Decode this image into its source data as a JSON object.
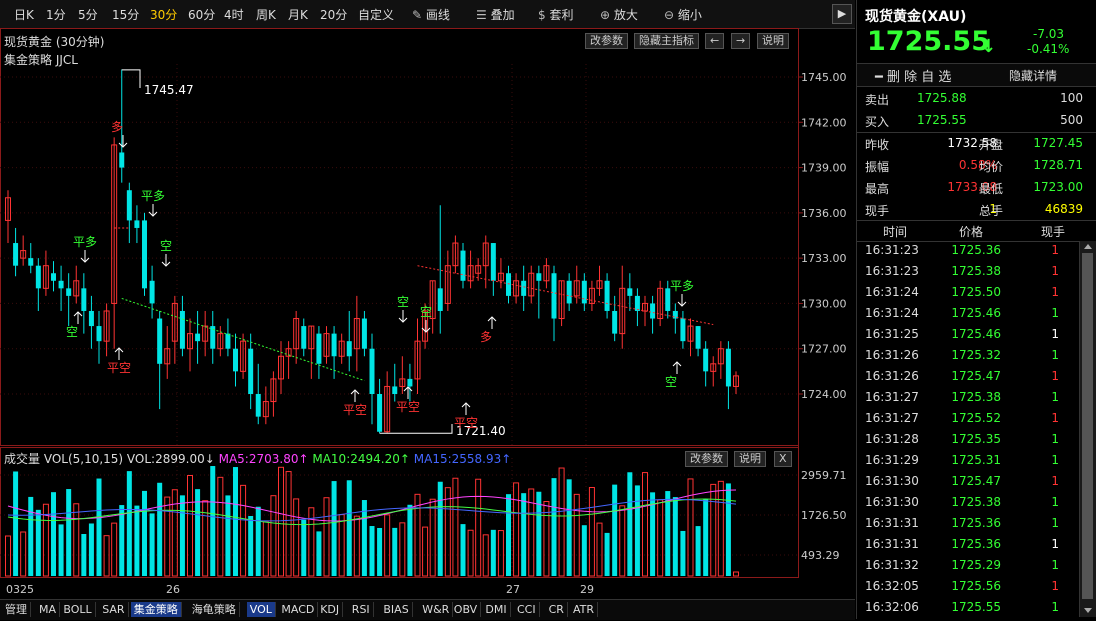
{
  "toolbar": {
    "periods": [
      "日K",
      "1分",
      "5分",
      "15分",
      "30分",
      "60分",
      "4时",
      "周K",
      "月K",
      "20分",
      "自定义"
    ],
    "active_period": "30分",
    "tools": [
      {
        "icon": "pencil-icon",
        "label": "画线"
      },
      {
        "icon": "stack-icon",
        "label": "叠加"
      },
      {
        "icon": "moneybag-icon",
        "label": "套利"
      },
      {
        "icon": "zoom-in-icon",
        "label": "放大"
      },
      {
        "icon": "zoom-out-icon",
        "label": "缩小"
      }
    ]
  },
  "main_chart": {
    "title": "现货黄金 (30分钟)",
    "strategy": "集金策略 JJCL",
    "buttons": {
      "modify": "改参数",
      "hide": "隐藏主指标",
      "left": "←",
      "right": "→",
      "help": "说明"
    },
    "price_ticks": [
      "1745.00",
      "1742.00",
      "1739.00",
      "1736.00",
      "1733.00",
      "1730.00",
      "1727.00",
      "1724.00"
    ],
    "high_label": "1745.47",
    "low_label": "1721.40",
    "signals": [
      "多",
      "平多",
      "空",
      "平空",
      "空",
      "空",
      "平空",
      "平空",
      "平空",
      "多",
      "平多",
      "空"
    ]
  },
  "volume": {
    "title": "成交量 VOL(5,10,15) VOL:2899.00↓",
    "ma5": "MA5:2703.80↑",
    "ma10": "MA10:2494.20↑",
    "ma15": "MA15:2558.93↑",
    "buttons": {
      "modify": "改参数",
      "help": "说明",
      "close": "X"
    },
    "ticks": [
      "2959.71",
      "1726.50",
      "493.29"
    ],
    "colors": {
      "ma5": "#ff44ff",
      "ma10": "#44ff44",
      "ma15": "#4466ff"
    }
  },
  "xaxis": {
    "labels": [
      "0325",
      "26",
      "27",
      "29"
    ]
  },
  "bottom_tabs": [
    "管理",
    "MA",
    "BOLL",
    "SAR",
    "集金策略",
    "海龟策略",
    "VOL",
    "MACD",
    "KDJ",
    "RSI",
    "BIAS",
    "W&R",
    "OBV",
    "DMI",
    "CCI",
    "CR",
    "ATR"
  ],
  "active_bottom": [
    "集金策略",
    "VOL"
  ],
  "quote": {
    "name": "现货黄金(XAU)",
    "price": "1725.55",
    "arrow": "↓",
    "change": "-7.03",
    "change_pct": "-0.41%",
    "delete_btn": "━ 删 除 自 选",
    "hide_btn": "隐藏详情",
    "sell_label": "卖出",
    "sell_price": "1725.88",
    "sell_vol": "100",
    "buy_label": "买入",
    "buy_price": "1725.55",
    "buy_vol": "500",
    "stats": [
      {
        "l1": "昨收",
        "v1": "1732.58",
        "c1": "#ffffff",
        "l2": "开盘",
        "v2": "1727.45",
        "c2": "#33ff33"
      },
      {
        "l1": "振幅",
        "v1": "0.58%",
        "c1": "#ff3333",
        "l2": "均价",
        "v2": "1728.71",
        "c2": "#33ff33"
      },
      {
        "l1": "最高",
        "v1": "1733.08",
        "c1": "#ff3333",
        "l2": "最低",
        "v2": "1723.00",
        "c2": "#33ff33"
      },
      {
        "l1": "现手",
        "v1": "1",
        "c1": "#ffff00",
        "l2": "总手",
        "v2": "46839",
        "c2": "#ffff00"
      }
    ],
    "ticks_header": [
      "时间",
      "价格",
      "现手"
    ],
    "ticks": [
      {
        "t": "16:31:23",
        "p": "1725.36",
        "v": "1",
        "vc": "#ff3333"
      },
      {
        "t": "16:31:23",
        "p": "1725.38",
        "v": "1",
        "vc": "#ff3333"
      },
      {
        "t": "16:31:24",
        "p": "1725.50",
        "v": "1",
        "vc": "#ff3333"
      },
      {
        "t": "16:31:24",
        "p": "1725.46",
        "v": "1",
        "vc": "#33ff33"
      },
      {
        "t": "16:31:25",
        "p": "1725.46",
        "v": "1",
        "vc": "#ffffff"
      },
      {
        "t": "16:31:26",
        "p": "1725.32",
        "v": "1",
        "vc": "#33ff33"
      },
      {
        "t": "16:31:26",
        "p": "1725.47",
        "v": "1",
        "vc": "#ff3333"
      },
      {
        "t": "16:31:27",
        "p": "1725.38",
        "v": "1",
        "vc": "#33ff33"
      },
      {
        "t": "16:31:27",
        "p": "1725.52",
        "v": "1",
        "vc": "#ff3333"
      },
      {
        "t": "16:31:28",
        "p": "1725.35",
        "v": "1",
        "vc": "#33ff33"
      },
      {
        "t": "16:31:29",
        "p": "1725.31",
        "v": "1",
        "vc": "#33ff33"
      },
      {
        "t": "16:31:30",
        "p": "1725.47",
        "v": "1",
        "vc": "#ff3333"
      },
      {
        "t": "16:31:30",
        "p": "1725.38",
        "v": "1",
        "vc": "#33ff33"
      },
      {
        "t": "16:31:31",
        "p": "1725.36",
        "v": "1",
        "vc": "#33ff33"
      },
      {
        "t": "16:31:31",
        "p": "1725.36",
        "v": "1",
        "vc": "#ffffff"
      },
      {
        "t": "16:31:32",
        "p": "1725.29",
        "v": "1",
        "vc": "#33ff33"
      },
      {
        "t": "16:32:05",
        "p": "1725.56",
        "v": "1",
        "vc": "#ff3333"
      },
      {
        "t": "16:32:06",
        "p": "1725.55",
        "v": "1",
        "vc": "#33ff33"
      }
    ]
  },
  "chart_data": {
    "type": "candlestick",
    "title": "现货黄金 (30分钟)",
    "ylim": [
      1721,
      1747
    ],
    "candles": [
      [
        1735.5,
        1737.0,
        1734.0,
        1737.5
      ],
      [
        1734.0,
        1732.5,
        1731.8,
        1735.0
      ],
      [
        1733.0,
        1733.5,
        1732.5,
        1734.5
      ],
      [
        1733.0,
        1732.5,
        1732.0,
        1734.0
      ],
      [
        1732.5,
        1731.0,
        1729.5,
        1733.0
      ],
      [
        1731.0,
        1732.5,
        1730.5,
        1733.5
      ],
      [
        1732.0,
        1731.5,
        1730.8,
        1732.8
      ],
      [
        1731.5,
        1731.0,
        1729.5,
        1732.5
      ],
      [
        1731.0,
        1730.5,
        1728.5,
        1732.0
      ],
      [
        1730.5,
        1731.5,
        1730.0,
        1732.5
      ],
      [
        1731.0,
        1729.5,
        1728.0,
        1732.0
      ],
      [
        1729.5,
        1728.5,
        1727.0,
        1730.5
      ],
      [
        1728.5,
        1727.5,
        1726.0,
        1729.5
      ],
      [
        1727.5,
        1729.5,
        1726.5,
        1730.0
      ],
      [
        1730.0,
        1740.5,
        1727.0,
        1741.0
      ],
      [
        1740.0,
        1739.0,
        1738.0,
        1745.5
      ],
      [
        1737.5,
        1735.5,
        1734.0,
        1738.0
      ],
      [
        1735.5,
        1735.0,
        1734.0,
        1736.5
      ],
      [
        1735.5,
        1731.0,
        1730.5,
        1736.0
      ],
      [
        1731.5,
        1730.0,
        1729.0,
        1732.5
      ],
      [
        1729.0,
        1726.0,
        1723.0,
        1729.5
      ],
      [
        1726.0,
        1727.0,
        1725.0,
        1728.5
      ],
      [
        1727.5,
        1730.0,
        1726.0,
        1730.5
      ],
      [
        1729.5,
        1727.0,
        1726.5,
        1730.5
      ],
      [
        1727.0,
        1728.0,
        1725.5,
        1729.0
      ],
      [
        1728.0,
        1727.5,
        1726.0,
        1729.5
      ],
      [
        1727.5,
        1728.5,
        1726.5,
        1729.5
      ],
      [
        1728.5,
        1727.0,
        1726.0,
        1729.5
      ],
      [
        1727.0,
        1728.0,
        1726.5,
        1728.5
      ],
      [
        1728.0,
        1727.0,
        1726.5,
        1729.0
      ],
      [
        1727.0,
        1725.5,
        1724.5,
        1728.0
      ],
      [
        1725.5,
        1727.5,
        1725.0,
        1728.0
      ],
      [
        1727.0,
        1724.0,
        1723.0,
        1728.0
      ],
      [
        1724.0,
        1722.5,
        1722.0,
        1726.0
      ],
      [
        1722.5,
        1723.5,
        1722.0,
        1724.5
      ],
      [
        1723.5,
        1725.0,
        1722.5,
        1725.5
      ],
      [
        1725.0,
        1726.5,
        1724.0,
        1727.5
      ],
      [
        1726.5,
        1727.0,
        1725.0,
        1727.5
      ],
      [
        1727.0,
        1729.0,
        1726.0,
        1729.5
      ],
      [
        1728.5,
        1727.0,
        1726.5,
        1729.0
      ],
      [
        1727.0,
        1728.5,
        1725.0,
        1728.5
      ],
      [
        1728.0,
        1726.0,
        1725.0,
        1728.5
      ],
      [
        1726.5,
        1728.0,
        1726.0,
        1728.5
      ],
      [
        1728.0,
        1726.5,
        1725.0,
        1728.5
      ],
      [
        1726.5,
        1727.5,
        1726.0,
        1728.0
      ],
      [
        1727.5,
        1726.5,
        1725.5,
        1729.5
      ],
      [
        1727.0,
        1729.0,
        1725.5,
        1730.5
      ],
      [
        1729.0,
        1727.0,
        1726.5,
        1729.5
      ],
      [
        1727.0,
        1724.0,
        1722.0,
        1728.0
      ],
      [
        1724.0,
        1721.5,
        1721.4,
        1725.0
      ],
      [
        1721.5,
        1724.5,
        1721.4,
        1725.5
      ],
      [
        1724.5,
        1724.0,
        1723.5,
        1726.0
      ],
      [
        1724.5,
        1725.0,
        1724.0,
        1726.5
      ],
      [
        1725.0,
        1724.5,
        1723.5,
        1726.0
      ],
      [
        1725.0,
        1727.5,
        1724.0,
        1729.0
      ],
      [
        1727.5,
        1729.5,
        1727.0,
        1730.0
      ],
      [
        1729.0,
        1731.5,
        1728.0,
        1731.5
      ],
      [
        1731.0,
        1729.5,
        1728.0,
        1736.5
      ],
      [
        1730.0,
        1732.5,
        1729.5,
        1733.5
      ],
      [
        1732.5,
        1734.0,
        1732.0,
        1734.5
      ],
      [
        1733.5,
        1731.5,
        1731.0,
        1734.0
      ],
      [
        1731.5,
        1732.5,
        1731.0,
        1733.5
      ],
      [
        1732.0,
        1732.5,
        1731.5,
        1733.0
      ],
      [
        1732.5,
        1734.0,
        1731.0,
        1734.5
      ],
      [
        1734.0,
        1731.5,
        1730.5,
        1734.0
      ],
      [
        1731.5,
        1732.0,
        1731.0,
        1733.0
      ],
      [
        1732.0,
        1730.5,
        1730.0,
        1732.5
      ],
      [
        1730.5,
        1731.5,
        1730.0,
        1732.0
      ],
      [
        1731.5,
        1730.5,
        1729.5,
        1732.5
      ],
      [
        1730.5,
        1732.0,
        1730.0,
        1732.5
      ],
      [
        1732.0,
        1731.5,
        1729.0,
        1732.5
      ],
      [
        1731.5,
        1732.5,
        1731.0,
        1733.0
      ],
      [
        1732.0,
        1729.0,
        1727.5,
        1732.5
      ],
      [
        1729.0,
        1731.5,
        1728.5,
        1731.5
      ],
      [
        1731.5,
        1730.0,
        1729.5,
        1732.0
      ],
      [
        1730.5,
        1731.5,
        1730.0,
        1732.5
      ],
      [
        1731.5,
        1730.0,
        1729.5,
        1732.0
      ],
      [
        1730.0,
        1731.0,
        1729.5,
        1731.5
      ],
      [
        1731.0,
        1731.5,
        1730.5,
        1732.5
      ],
      [
        1731.5,
        1729.5,
        1729.0,
        1732.0
      ],
      [
        1729.5,
        1728.0,
        1727.5,
        1730.5
      ],
      [
        1728.0,
        1731.0,
        1727.0,
        1732.5
      ],
      [
        1731.0,
        1730.5,
        1729.5,
        1732.0
      ],
      [
        1730.5,
        1729.5,
        1728.5,
        1731.0
      ],
      [
        1729.5,
        1730.0,
        1728.5,
        1730.5
      ],
      [
        1730.0,
        1729.0,
        1728.0,
        1730.5
      ],
      [
        1729.0,
        1731.0,
        1728.5,
        1731.5
      ],
      [
        1731.0,
        1729.5,
        1729.0,
        1731.5
      ],
      [
        1729.5,
        1729.0,
        1728.0,
        1730.0
      ],
      [
        1729.0,
        1727.5,
        1727.0,
        1729.5
      ],
      [
        1727.5,
        1728.5,
        1726.5,
        1729.0
      ],
      [
        1728.5,
        1727.0,
        1726.5,
        1728.5
      ],
      [
        1727.0,
        1725.5,
        1724.5,
        1727.5
      ],
      [
        1725.5,
        1726.0,
        1724.5,
        1726.5
      ],
      [
        1726.0,
        1727.0,
        1725.0,
        1727.5
      ],
      [
        1727.0,
        1724.5,
        1723.0,
        1727.5
      ],
      [
        1724.5,
        1725.2,
        1724.0,
        1725.5
      ]
    ]
  }
}
